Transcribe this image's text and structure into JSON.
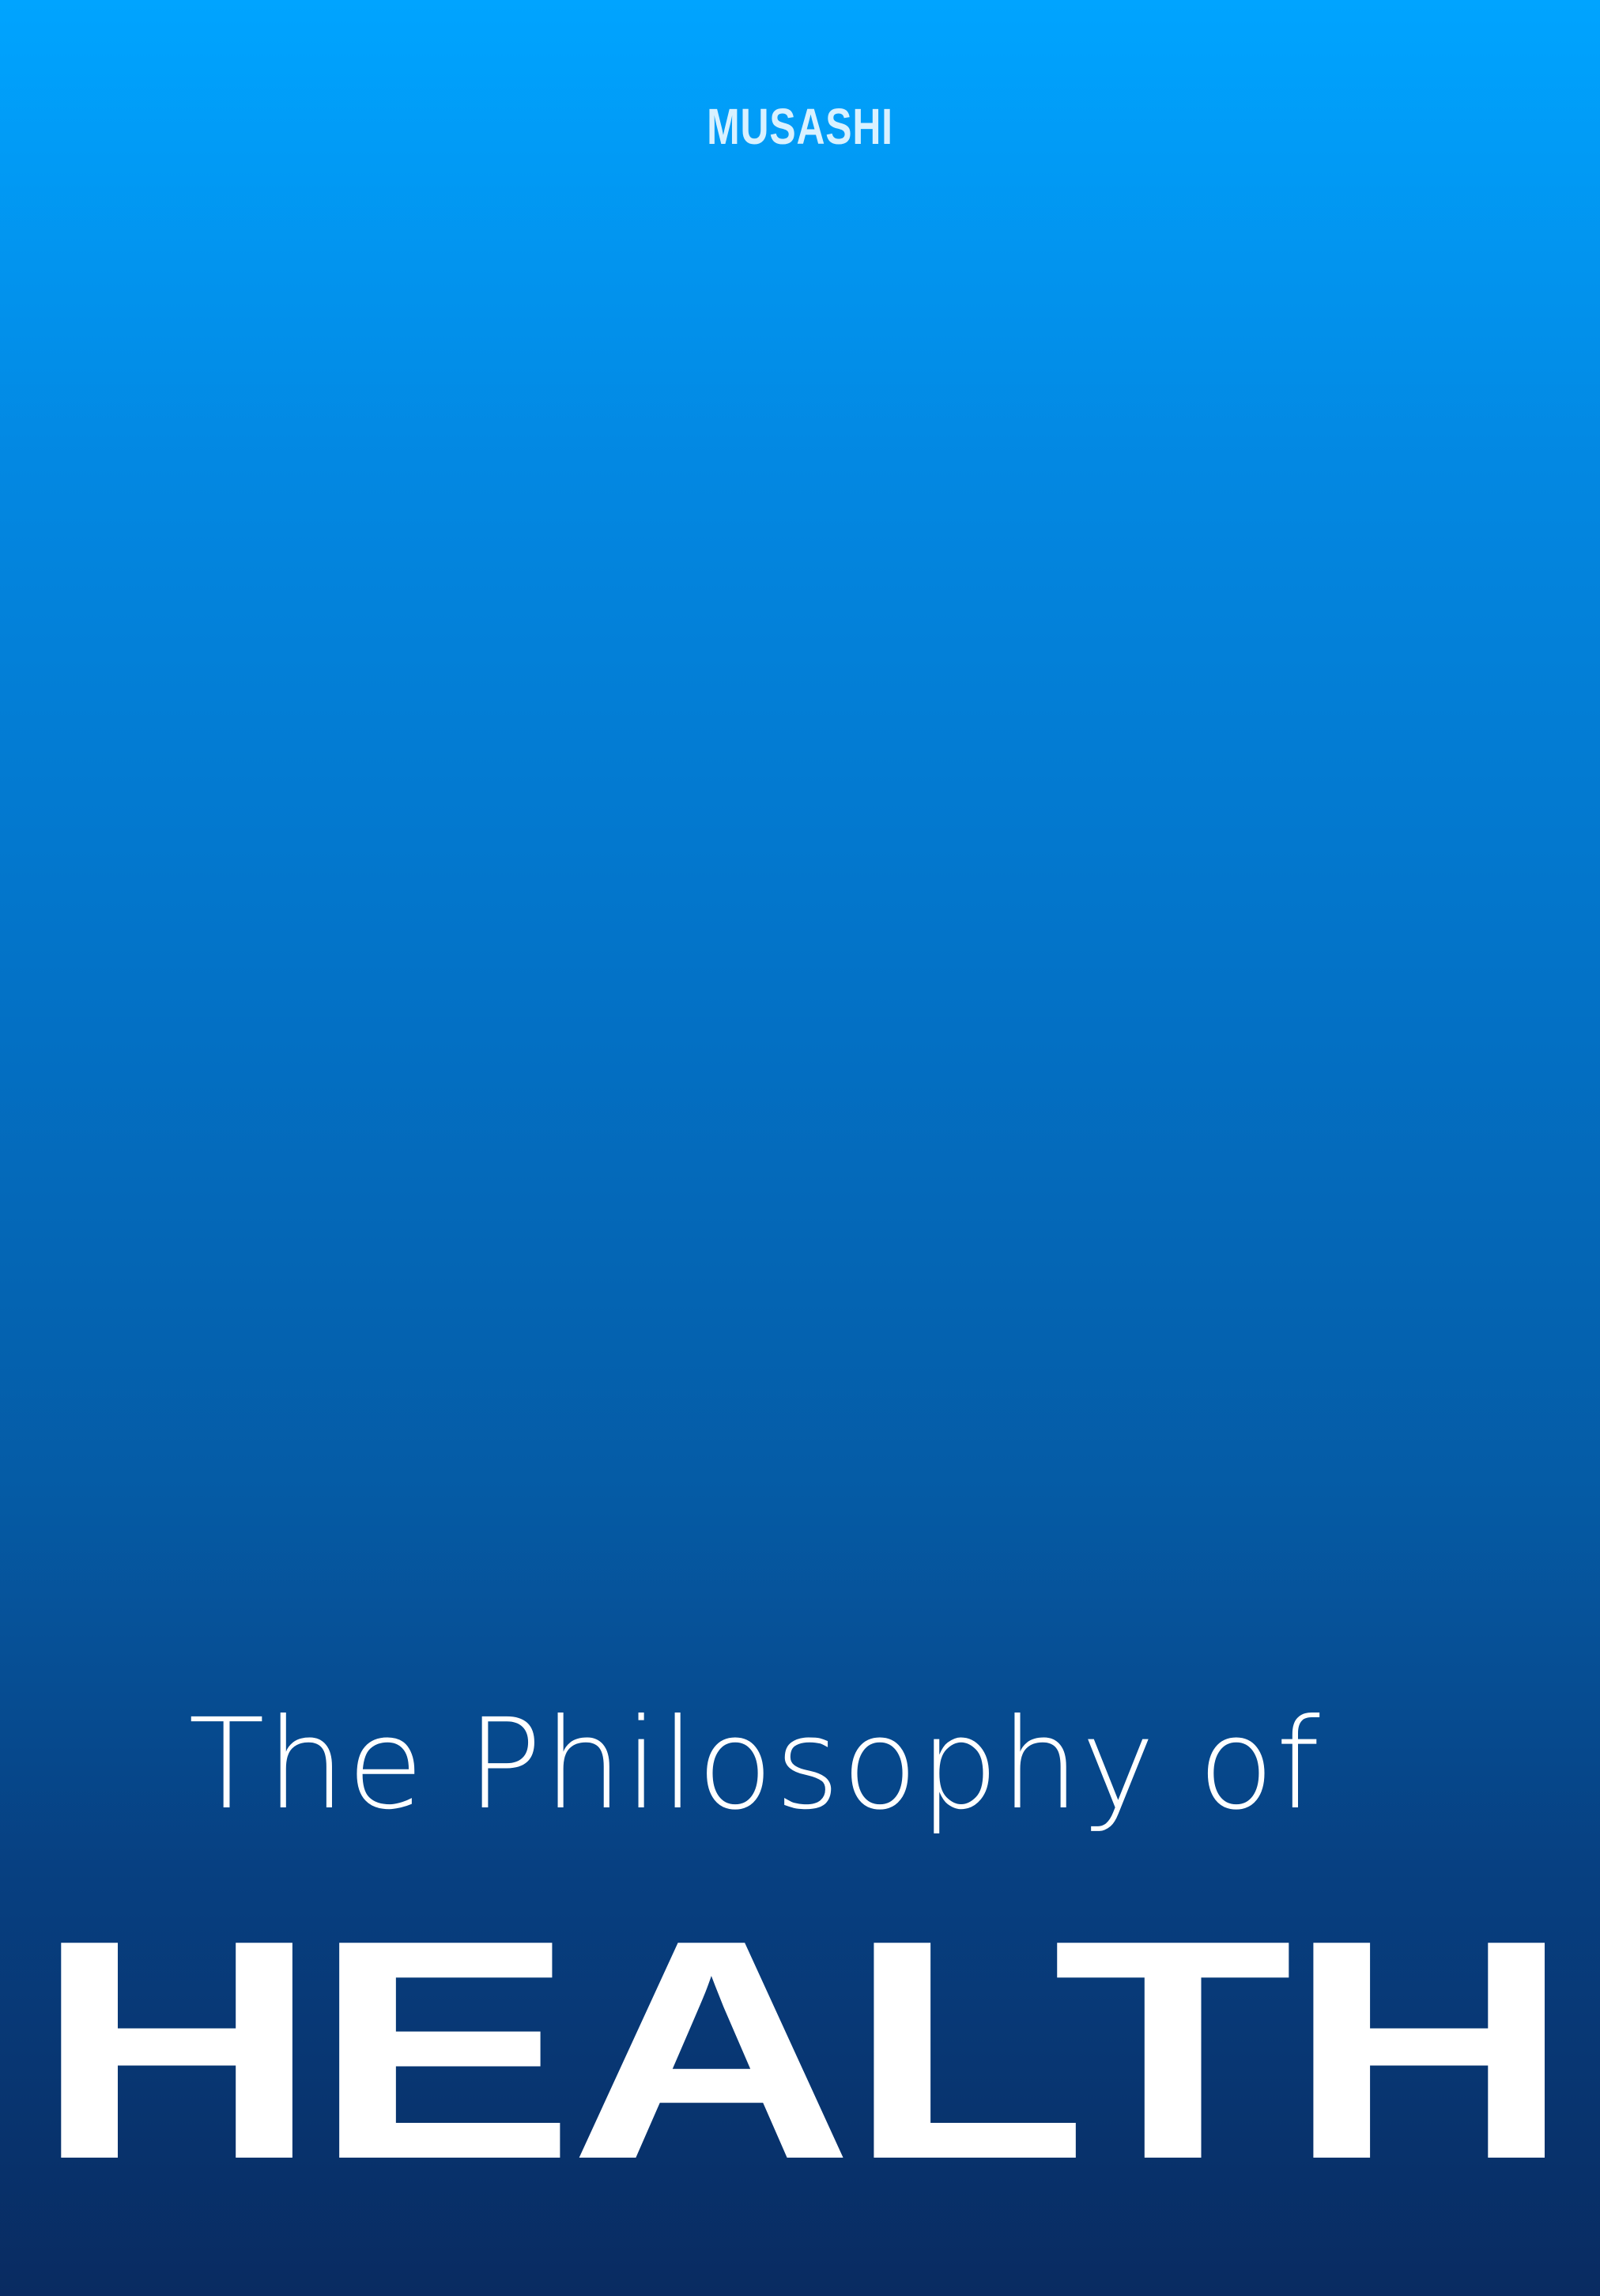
{
  "cover": {
    "brand": "MUSASHI",
    "subtitle": "The Philosophy of",
    "headline": "HEALTH"
  },
  "colors": {
    "gradient_top": "#00a4ff",
    "gradient_bottom": "#092b61",
    "brand_text": "#d9f1ff",
    "title_text": "#ffffff"
  }
}
